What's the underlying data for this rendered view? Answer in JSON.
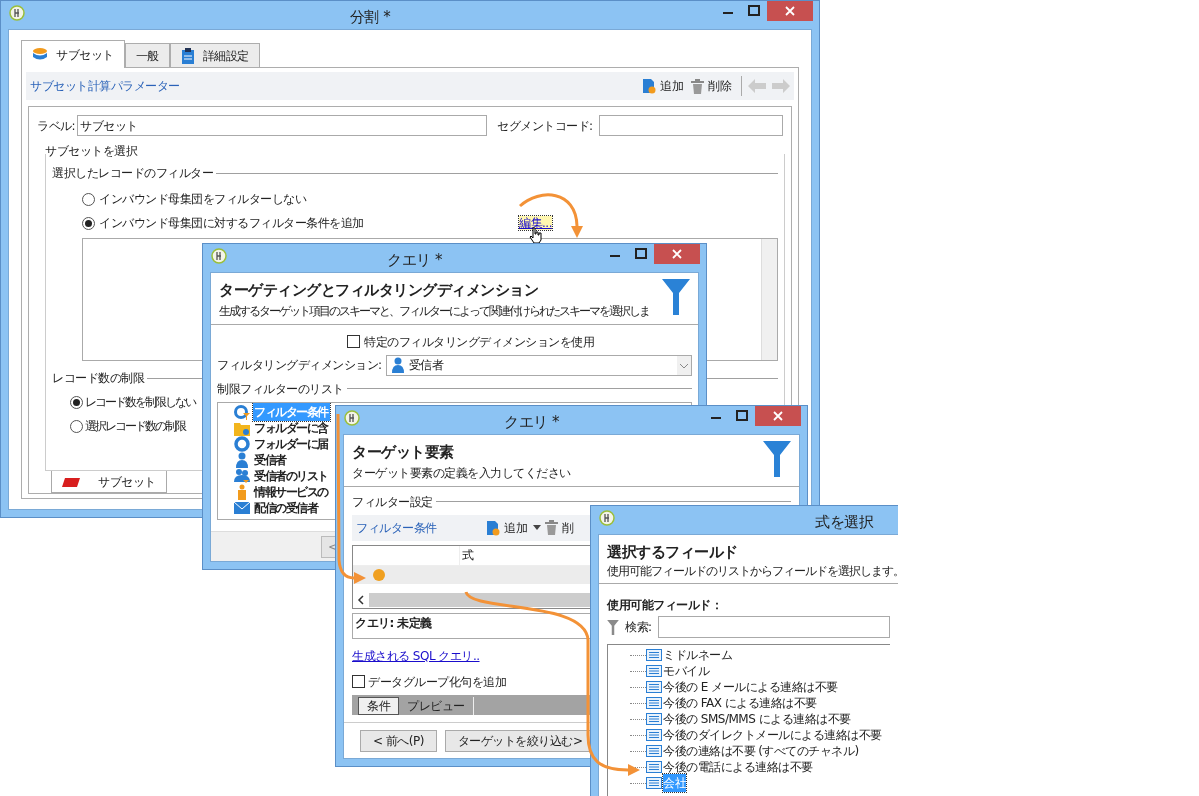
{
  "main_window": {
    "title": "分割 *",
    "tabs": [
      {
        "label": "サブセット",
        "selected": true,
        "kind": "database"
      },
      {
        "label": "一般",
        "selected": false,
        "kind": "none"
      },
      {
        "label": "詳細設定",
        "selected": false,
        "kind": "clipboard"
      }
    ],
    "toolbar": {
      "title": "サブセット計算パラメーター",
      "add": "追加",
      "delete": "削除"
    },
    "label_field": {
      "label": "ラベル:",
      "value": "サブセット"
    },
    "segment_field": {
      "label": "セグメントコード:"
    },
    "subset_group": "サブセットを選択",
    "filter_group": {
      "title": "選択したレコードのフィルター",
      "edit_link": "編集...",
      "options": [
        {
          "label": "インバウンド母集団をフィルターしない",
          "selected": false
        },
        {
          "label": "インバウンド母集団に対するフィルター条件を追加",
          "selected": true
        }
      ]
    },
    "limit_group": {
      "title": "レコード数の制限",
      "options": [
        {
          "label": "レコード数を制限しない",
          "selected": true
        },
        {
          "label": "選択レコード数の制限",
          "selected": false
        }
      ]
    },
    "bottom_tab": "サブセット"
  },
  "query_window_1": {
    "title": "クエリ *",
    "heading": "ターゲティングとフィルタリングディメンション",
    "subheading": "生成するターゲット項目のスキーマと、フィルターによって関連付けられたスキーマを選択しま",
    "specific_dimension": {
      "label": "特定のフィルタリングディメンションを使用",
      "checked": false
    },
    "dimension_field": {
      "label": "フィルタリングディメンション:",
      "value": "受信者"
    },
    "list_title": "制限フィルターのリスト",
    "items": [
      {
        "label": "フィルター条件",
        "selected": true,
        "kind": "condition"
      },
      {
        "label": "フォルダーに含",
        "selected": false,
        "kind": "folder"
      },
      {
        "label": "フォルダーに届",
        "selected": false,
        "kind": "ring"
      },
      {
        "label": "受信者",
        "selected": false,
        "kind": "person"
      },
      {
        "label": "受信者のリスト",
        "selected": false,
        "kind": "people"
      },
      {
        "label": "情報サービスの",
        "selected": false,
        "kind": "service"
      },
      {
        "label": "配信の受信者",
        "selected": false,
        "kind": "mail"
      }
    ],
    "footer_button": "<"
  },
  "query_window_2": {
    "title": "クエリ *",
    "heading": "ターゲット要素",
    "subheading": "ターゲット要素の定義を入力してください",
    "filter_group": "フィルター設定",
    "toolbar": {
      "title": "フィルター条件",
      "add": "追加",
      "delete": "削"
    },
    "column": "式",
    "query_status": "クエリ: 未定義",
    "sql_link": "生成される SQL クエリ..",
    "group_by": {
      "label": "データグループ化句を追加",
      "checked": false
    },
    "tabs": [
      {
        "label": "条件",
        "selected": true
      },
      {
        "label": "プレビュー",
        "selected": false
      }
    ],
    "buttons": [
      "< 前へ(P)",
      "ターゲットを絞り込む>"
    ]
  },
  "expression_window": {
    "title": "式を選択",
    "heading": "選択するフィールド",
    "subheading": "使用可能フィールドのリストからフィールドを選択します。",
    "fields_label": "使用可能フィールド：",
    "search_label": "検索:",
    "fields": [
      {
        "label": "ミドルネーム",
        "selected": false
      },
      {
        "label": "モバイル",
        "selected": false
      },
      {
        "label": "今後の E メールによる連絡は不要",
        "selected": false
      },
      {
        "label": "今後の FAX による連絡は不要",
        "selected": false
      },
      {
        "label": "今後の SMS/MMS による連絡は不要",
        "selected": false
      },
      {
        "label": "今後のダイレクトメールによる連絡は不要",
        "selected": false
      },
      {
        "label": "今後の連絡は不要 (すべてのチャネル)",
        "selected": false
      },
      {
        "label": "今後の電話による連絡は不要",
        "selected": false
      },
      {
        "label": "会社",
        "selected": true
      }
    ]
  }
}
